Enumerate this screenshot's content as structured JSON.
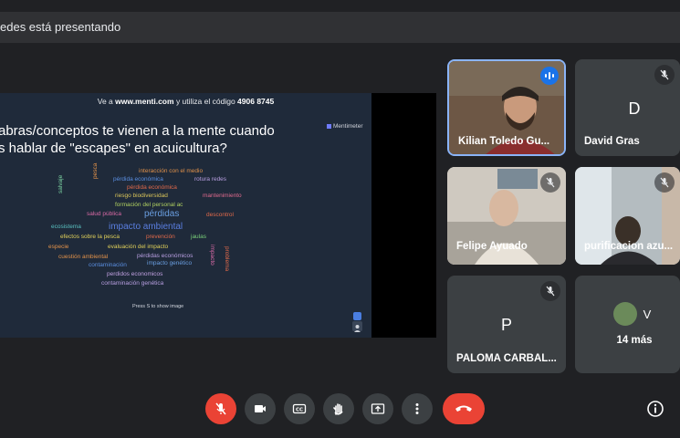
{
  "banner": {
    "text": "edes está presentando"
  },
  "slide": {
    "code_prefix": "Ve a",
    "code_site": "www.menti.com",
    "code_middle": "y utiliza el código",
    "code_value": "4906 8745",
    "question_line1": "abras/conceptos te vienen a la mente cuando",
    "question_line2": "s hablar de \"escapes\" en acuicultura?",
    "brand": "Mentimeter",
    "press_hint": "Press S to show image",
    "words": [
      {
        "text": "interacción con el medio",
        "color": "#e0914a"
      },
      {
        "text": "pérdida económica",
        "color": "#5a8ee0"
      },
      {
        "text": "rotura redes",
        "color": "#b79ee0"
      },
      {
        "text": "pérdida económica",
        "color": "#e0694a"
      },
      {
        "text": "pesca",
        "color": "#e0914a"
      },
      {
        "text": "riesgo biodiversidad",
        "color": "#d9c45a"
      },
      {
        "text": "mantenimiento",
        "color": "#e06a8e"
      },
      {
        "text": "salvaje",
        "color": "#7ad0a0"
      },
      {
        "text": "formación del personal ac",
        "color": "#b0d060"
      },
      {
        "text": "salud pública",
        "color": "#d96aa6"
      },
      {
        "text": "pérdidas",
        "color": "#6a9ee0"
      },
      {
        "text": "descontrol",
        "color": "#e0694a"
      },
      {
        "text": "ecosistema",
        "color": "#5ac0c0"
      },
      {
        "text": "impacto ambiental",
        "color": "#5a7ee0"
      },
      {
        "text": "efectos sobre la pesca",
        "color": "#e0d05a"
      },
      {
        "text": "prevención",
        "color": "#e0694a"
      },
      {
        "text": "jaulas",
        "color": "#7ad07a"
      },
      {
        "text": "especie",
        "color": "#e0914a"
      },
      {
        "text": "evaluación del impacto",
        "color": "#e0d05a"
      },
      {
        "text": "impacto",
        "color": "#d96aa6"
      },
      {
        "text": "problema",
        "color": "#e0694a"
      },
      {
        "text": "cuestión ambiental",
        "color": "#e0914a"
      },
      {
        "text": "pérdidas económicos",
        "color": "#b79ee0"
      },
      {
        "text": "contaminación",
        "color": "#5a8ee0"
      },
      {
        "text": "impacto genético",
        "color": "#6a9ee0"
      },
      {
        "text": "perdidos economicos",
        "color": "#c0a0e0"
      },
      {
        "text": "contaminación genética",
        "color": "#b79ee0"
      }
    ]
  },
  "participants": [
    {
      "name": "Kilian Toledo Gu...",
      "speaking": true
    },
    {
      "name": "David Gras",
      "initial": "D",
      "avatar_color": "#00796b"
    },
    {
      "name": "Felipe Ayuado"
    },
    {
      "name": "purificacion azu..."
    },
    {
      "name": "PALOMA CARBAL...",
      "initial": "P",
      "avatar_color": "#00897b"
    },
    {
      "more_label": "14 más",
      "initial": "V",
      "avatar_color": "#8e24aa"
    }
  ],
  "colors": {
    "accent": "#8ab4f8",
    "end_call": "#ea4335",
    "tile": "#3c4043"
  },
  "controls": [
    "mic-off-icon",
    "camera-icon",
    "captions-icon",
    "raise-hand-icon",
    "present-icon",
    "more-icon",
    "end-call-icon",
    "info-icon"
  ]
}
